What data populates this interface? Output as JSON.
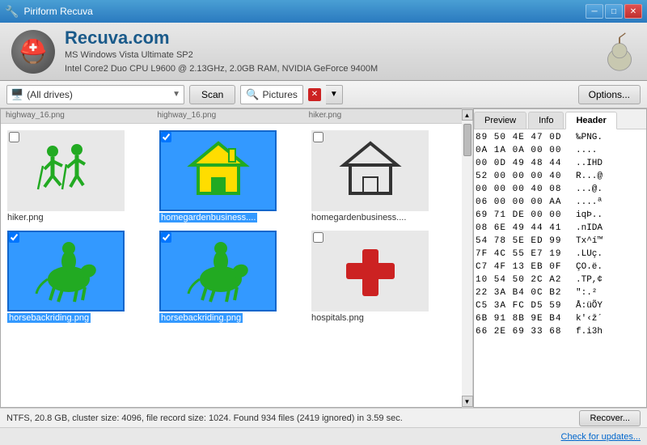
{
  "titleBar": {
    "icon": "🔧",
    "title": "Piriform Recuva",
    "buttons": {
      "minimize": "─",
      "maximize": "□",
      "close": "✕"
    }
  },
  "header": {
    "appName": "Recuva.com",
    "subtitle1": "MS Windows Vista Ultimate SP2",
    "subtitle2": "Intel Core2 Duo CPU L9600 @ 2.13GHz, 2.0GB RAM, NVIDIA GeForce 9400M",
    "pear": "🍐"
  },
  "toolbar": {
    "driveLabel": "(All drives)",
    "scanLabel": "Scan",
    "fileType": "Pictures",
    "optionsLabel": "Options..."
  },
  "fileHeaders": [
    "highway_16.png",
    "highway_16.png",
    "hiker.png"
  ],
  "files": [
    {
      "name": "hiker.png",
      "selected": false,
      "checked": false,
      "type": "hiker"
    },
    {
      "name": "homegardenbusiness....",
      "selected": true,
      "checked": true,
      "type": "house"
    },
    {
      "name": "homegardenbusiness....",
      "selected": false,
      "checked": false,
      "type": "house_outline"
    },
    {
      "name": "horsebackriding.png",
      "selected": true,
      "checked": true,
      "type": "horse"
    },
    {
      "name": "horsebackriding.png",
      "selected": true,
      "checked": true,
      "type": "horse"
    },
    {
      "name": "hospitals.png",
      "selected": false,
      "checked": false,
      "type": "hospital"
    }
  ],
  "previewTabs": [
    "Preview",
    "Info",
    "Header"
  ],
  "activeTab": "Header",
  "hexData": [
    {
      "bytes": "89 50 4E 47 0D",
      "ascii": "‰PNG."
    },
    {
      "bytes": "0A 1A 0A 00 00",
      "ascii": "...."
    },
    {
      "bytes": "00 0D 49 48 44",
      "ascii": "..IHD"
    },
    {
      "bytes": "52 00 00 00 40",
      "ascii": "R...@"
    },
    {
      "bytes": "00 00 00 40 08",
      "ascii": "...@."
    },
    {
      "bytes": "06 00 00 00 AA",
      "ascii": "....ª"
    },
    {
      "bytes": "69 71 DE 00 00",
      "ascii": "iqÞ.."
    },
    {
      "bytes": "08 6E 49 44 41",
      "ascii": ".nIDA"
    },
    {
      "bytes": "54 78 5E ED 99",
      "ascii": "Tx^í™"
    },
    {
      "bytes": "7F 4C 55 E7 19",
      "ascii": ".LUç."
    },
    {
      "bytes": "C7 4F 13 EB 0F",
      "ascii": "ÇO.ë."
    },
    {
      "bytes": "10 54 50 2C A2",
      "ascii": ".TP,¢"
    },
    {
      "bytes": "22 3A B4 0C B2",
      "ascii": "\":.²"
    },
    {
      "bytes": "C5 3A FC D5 59",
      "ascii": "Å:üÕY"
    },
    {
      "bytes": "6B 91 8B 9E B4",
      "ascii": "k'‹ž´"
    },
    {
      "bytes": "66 2E 69 33 68",
      "ascii": "f.i3h"
    }
  ],
  "statusBar": {
    "text": "NTFS, 20.8 GB, cluster size: 4096, file record size: 1024. Found 934 files (2419 ignored) in 3.59 sec.",
    "recoverLabel": "Recover..."
  },
  "linkBar": {
    "checkUpdates": "Check for updates..."
  }
}
